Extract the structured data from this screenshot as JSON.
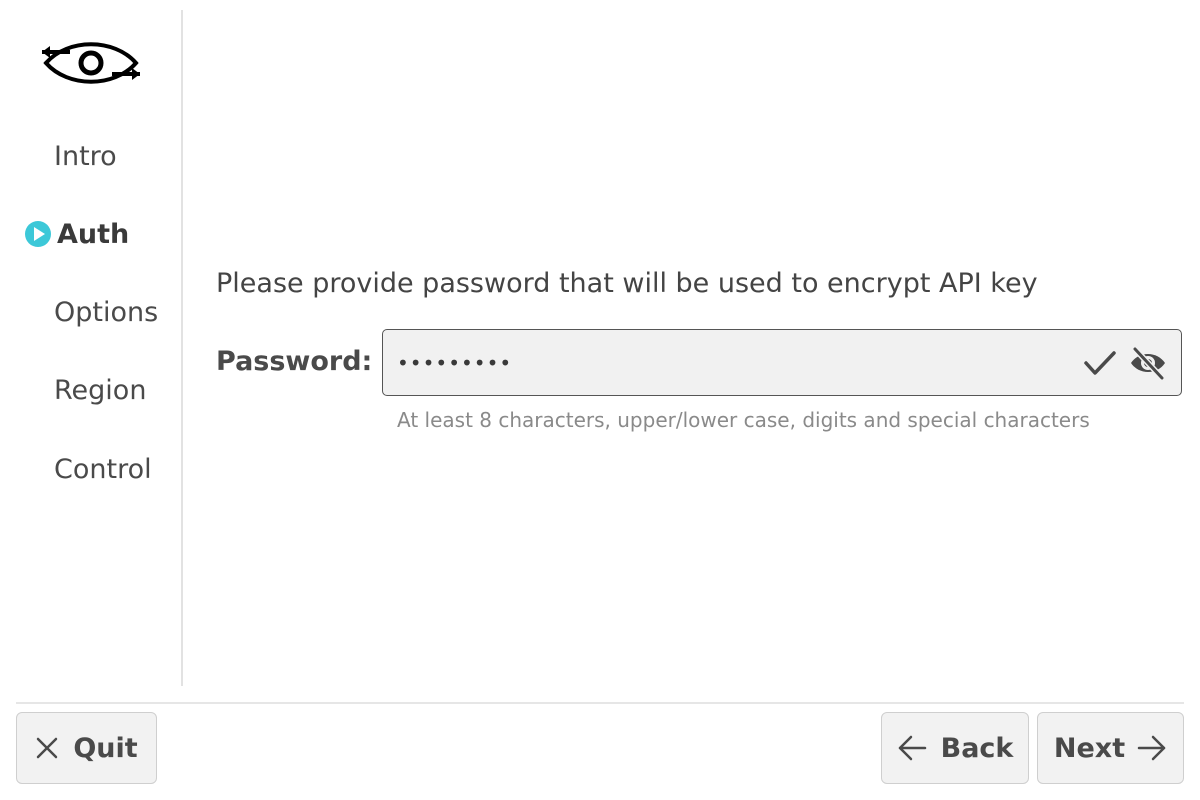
{
  "sidebar": {
    "logo_icon": "eye-arrows-logo",
    "items": [
      {
        "label": "Intro",
        "active": false
      },
      {
        "label": "Auth",
        "active": true
      },
      {
        "label": "Options",
        "active": false
      },
      {
        "label": "Region",
        "active": false
      },
      {
        "label": "Control",
        "active": false
      }
    ],
    "active_marker_color": "#3cc8d8"
  },
  "main": {
    "prompt": "Please provide password that will be used to encrypt API key",
    "password": {
      "label": "Password:",
      "value": "•••••••••",
      "hint": "At least 8 characters, upper/lower case, digits and special characters",
      "valid_icon": "checkmark-icon",
      "visibility_icon": "eye-off-icon"
    }
  },
  "footer": {
    "quit_label": "Quit",
    "back_label": "Back",
    "next_label": "Next"
  }
}
